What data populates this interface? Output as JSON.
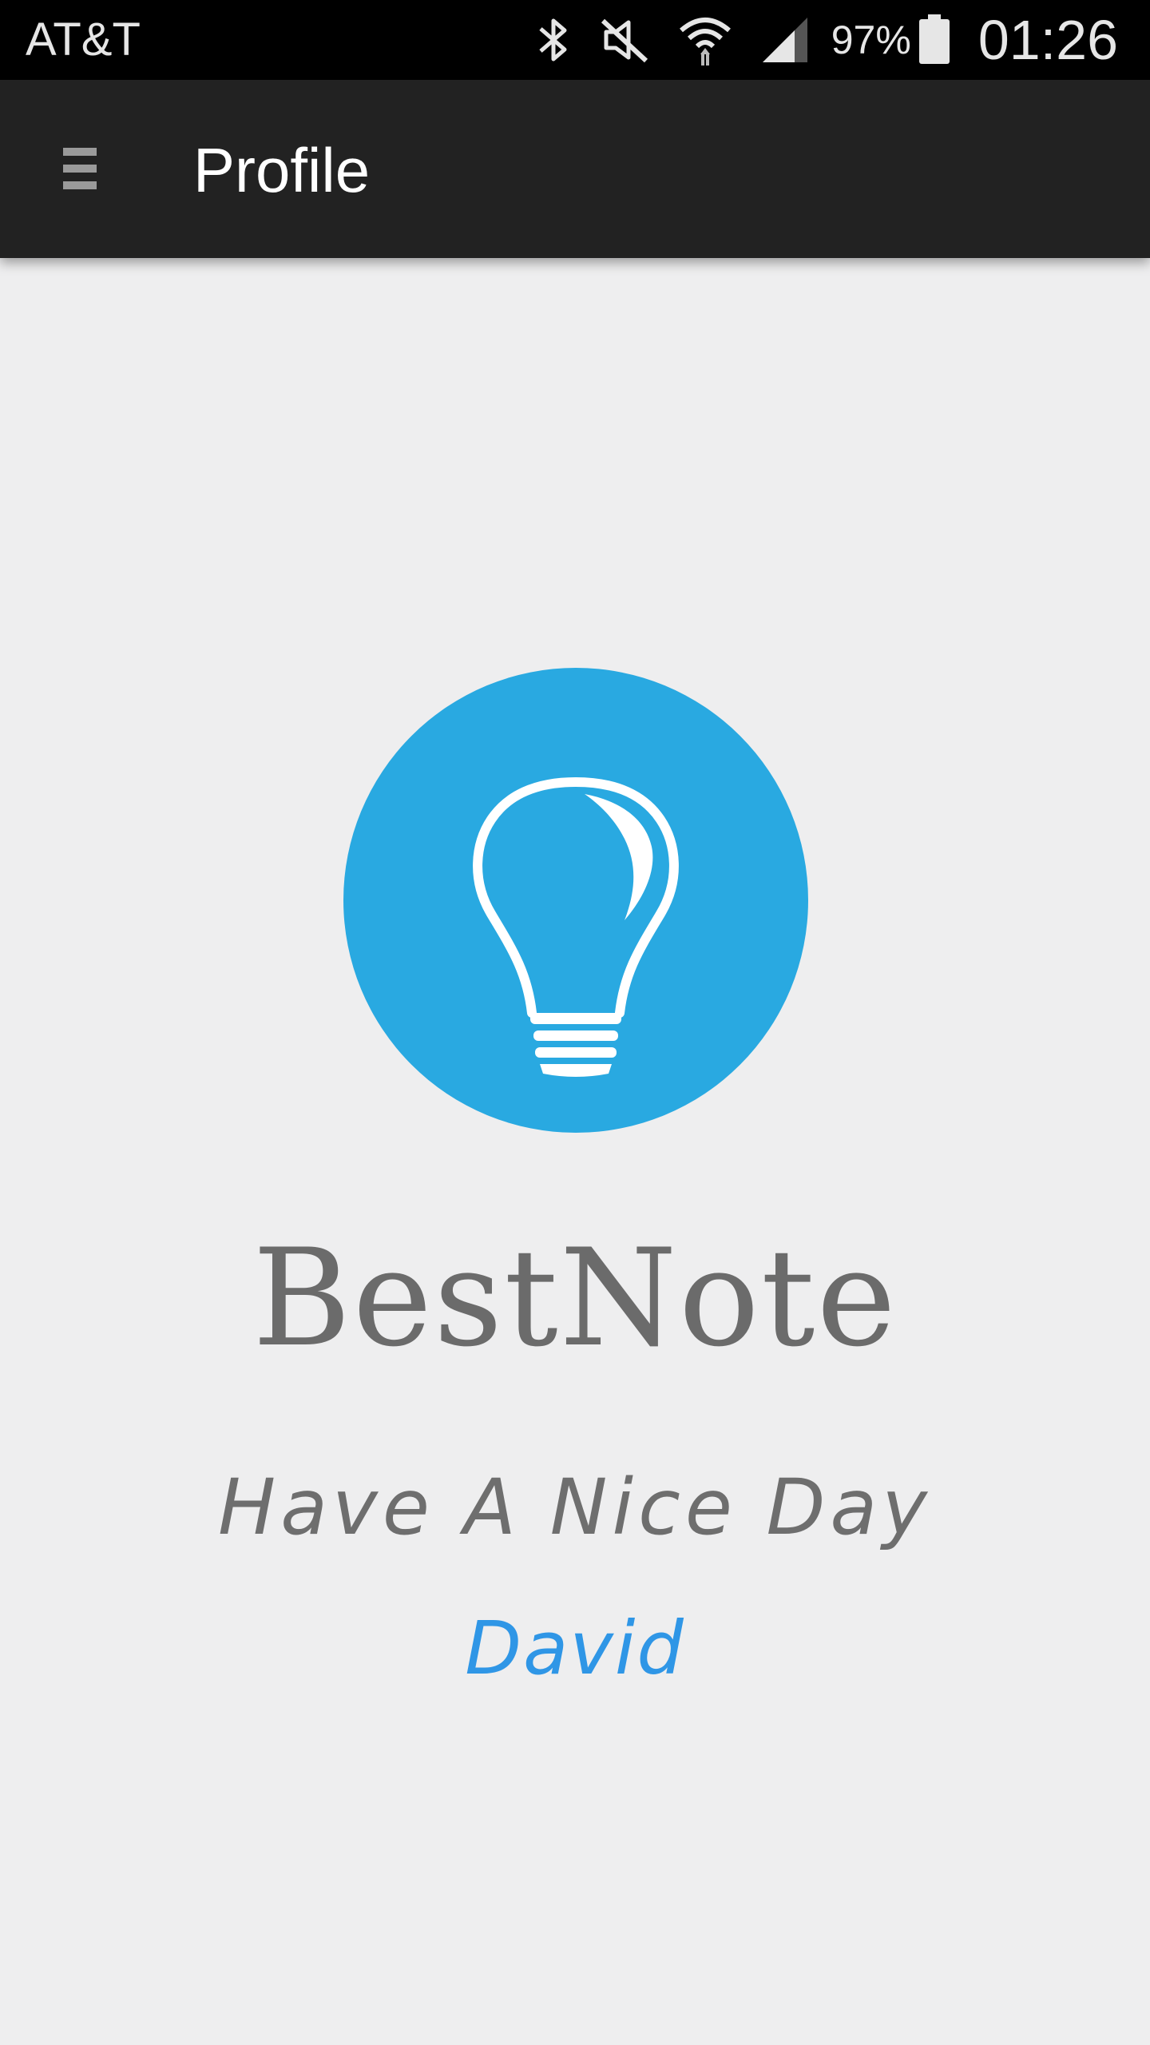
{
  "status_bar": {
    "carrier": "AT&T",
    "battery_percent": "97%",
    "time": "01:26",
    "icons": [
      "bluetooth-icon",
      "muted-icon",
      "wifi-icon",
      "signal-icon",
      "battery-icon"
    ]
  },
  "app_bar": {
    "title": "Profile",
    "menu_icon": "hamburger-menu-icon"
  },
  "profile": {
    "logo_icon": "lightbulb-icon",
    "app_name": "BestNote",
    "greeting": "Have A Nice Day",
    "user_name": "David"
  },
  "colors": {
    "status_bar_bg": "#000000",
    "app_bar_bg": "#222222",
    "page_bg": "#eeeeef",
    "logo_circle": "#29a9e1",
    "user_name": "#2f96e6",
    "text_gray": "#6b6b6b"
  }
}
